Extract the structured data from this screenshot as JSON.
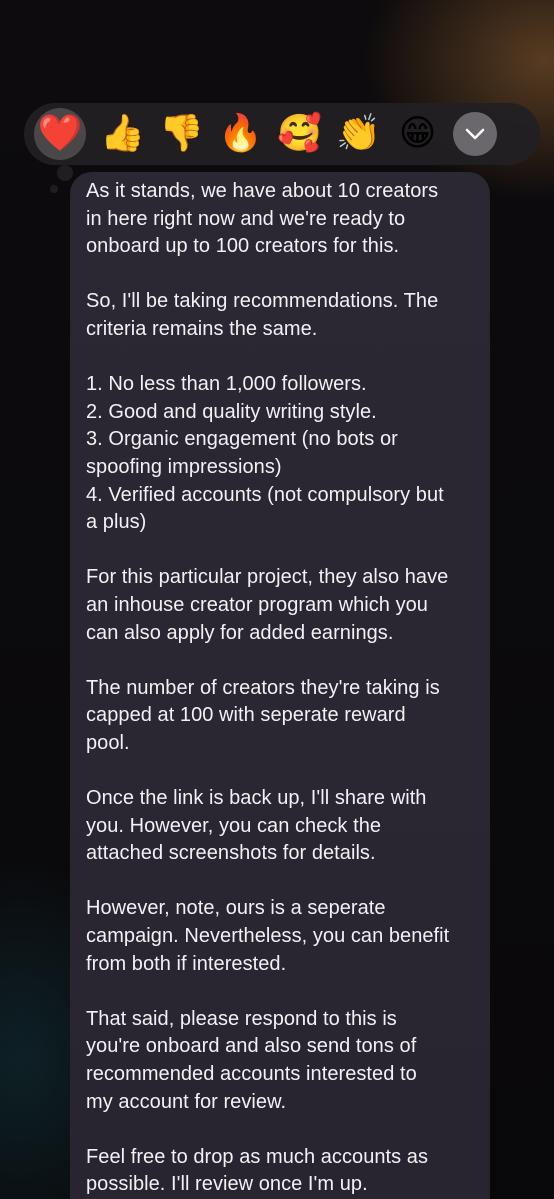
{
  "reactions": [
    {
      "name": "red-heart",
      "glyph": "❤️",
      "selected": true
    },
    {
      "name": "thumbs-up",
      "glyph": "👍"
    },
    {
      "name": "thumbs-down",
      "glyph": "👎"
    },
    {
      "name": "fire",
      "glyph": "🔥"
    },
    {
      "name": "smiling-face-with-hearts",
      "glyph": "🥰"
    },
    {
      "name": "clapping-hands",
      "glyph": "👏"
    },
    {
      "name": "beaming-face",
      "glyph": "😁"
    }
  ],
  "expand_icon": "chevron-down-icon",
  "message": {
    "lines": [
      "As it stands, we have about 10 creators",
      "in here right now and we're ready to",
      "onboard up to 100 creators for this.",
      "",
      "So, I'll be taking recommendations. The",
      "criteria remains the same.",
      "",
      "1. No less than 1,000 followers.",
      "2. Good and quality writing style.",
      "3. Organic engagement (no bots or",
      "spoofing impressions)",
      "4. Verified accounts (not compulsory but",
      "a plus)",
      "",
      "For this particular project, they also have",
      "an inhouse creator program which you",
      "can also apply for added earnings.",
      "",
      "The number of creators they're taking is",
      "capped at 100 with seperate reward",
      "pool.",
      "",
      "Once the link is back up, I'll share with",
      "you. However, you can check the",
      "attached screenshots for details.",
      "",
      "However, note, ours is a seperate",
      "campaign. Nevertheless, you can benefit",
      "from both if interested.",
      "",
      "That said, please respond to this is",
      "you're onboard and also send tons of",
      "recommended accounts interested to",
      "my account for review.",
      "",
      "Feel free to drop as much accounts as",
      "possible. I'll review once I'm up."
    ]
  },
  "colors": {
    "bubble": "#2a2632",
    "reaction_bar": "#222023",
    "selected_reaction_bg": "#4a4749",
    "expand_button_bg": "#6a686c",
    "text": "#f2f1f3"
  }
}
